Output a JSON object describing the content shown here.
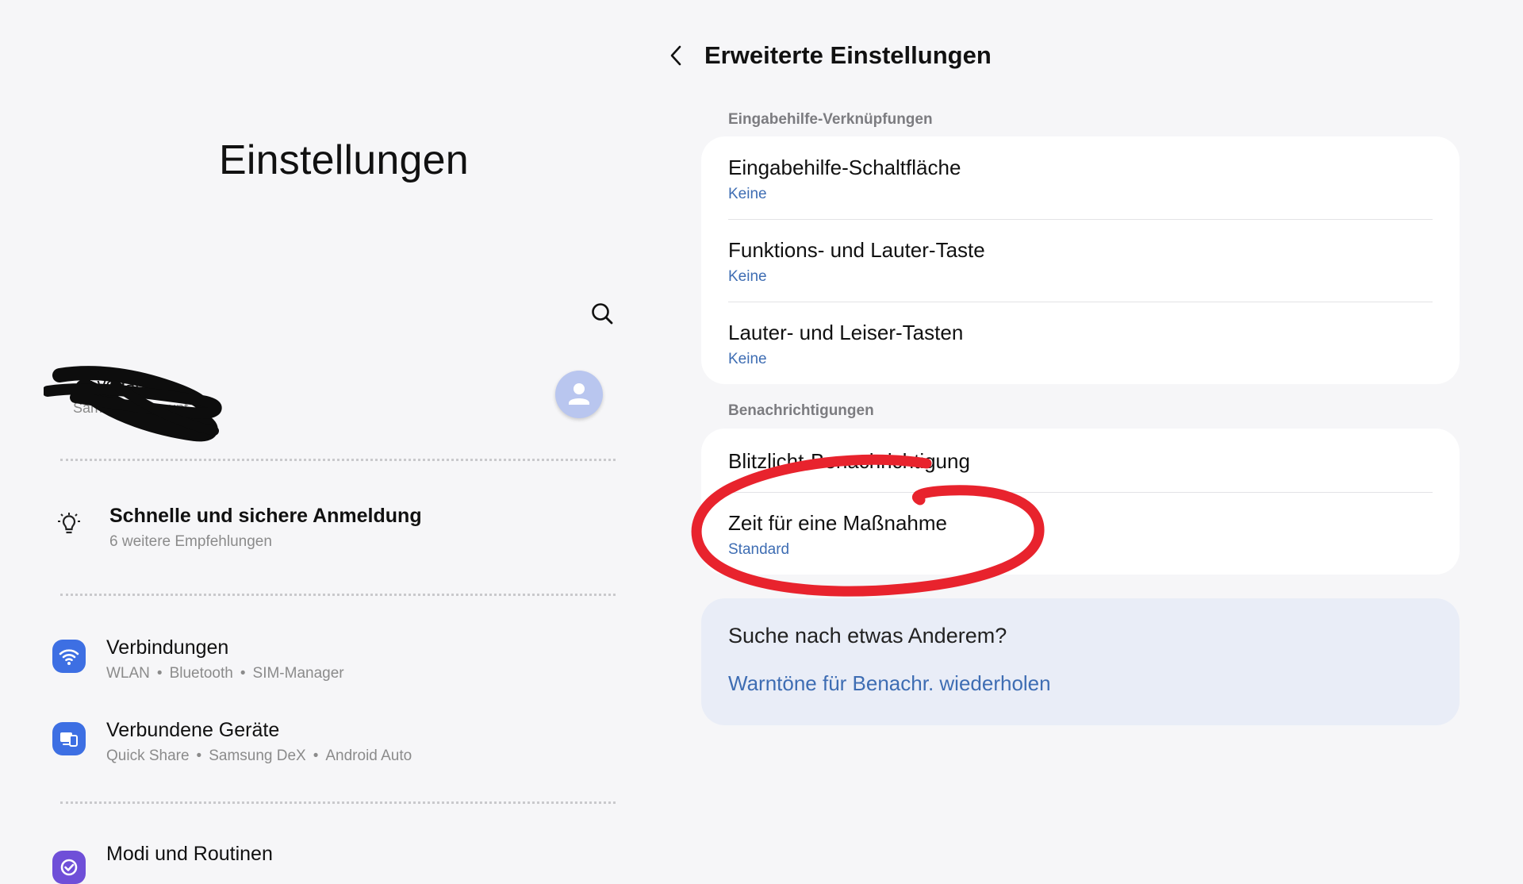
{
  "left": {
    "title": "Einstellungen",
    "account": {
      "name": "...t vogab",
      "subtitle": "Samsung Account"
    },
    "recommendation": {
      "title": "Schnelle und sichere Anmeldung",
      "subtitle": "6 weitere Empfehlungen"
    },
    "items": [
      {
        "title": "Verbindungen",
        "parts": [
          "WLAN",
          "Bluetooth",
          "SIM-Manager"
        ],
        "icon": "wifi-icon",
        "color": "#3d6fe3"
      },
      {
        "title": "Verbundene Geräte",
        "parts": [
          "Quick Share",
          "Samsung DeX",
          "Android Auto"
        ],
        "icon": "devices-icon",
        "color": "#3d6fe3"
      },
      {
        "title": "Modi und Routinen",
        "icon": "routine-icon",
        "color": "#6f4fd8"
      }
    ]
  },
  "right": {
    "header_title": "Erweiterte Einstellungen",
    "sections": [
      {
        "header": "Eingabehilfe-Verknüpfungen",
        "rows": [
          {
            "title": "Eingabehilfe-Schaltfläche",
            "value": "Keine"
          },
          {
            "title": "Funktions- und Lauter-Taste",
            "value": "Keine"
          },
          {
            "title": "Lauter- und Leiser-Tasten",
            "value": "Keine"
          }
        ]
      },
      {
        "header": "Benachrichtigungen",
        "rows": [
          {
            "title": "Blitzlicht-Benachrichtigung"
          },
          {
            "title": "Zeit für eine Maßnahme",
            "value": "Standard"
          }
        ]
      }
    ],
    "suggestion": {
      "question": "Suche nach etwas Anderem?",
      "link": "Warntöne für Benachr. wiederholen"
    }
  },
  "colors": {
    "accent": "#3e6db3",
    "annotation": "#e8232d",
    "background": "#f6f6f8",
    "card": "#ffffff",
    "suggestion_bg": "#e9edf7"
  }
}
